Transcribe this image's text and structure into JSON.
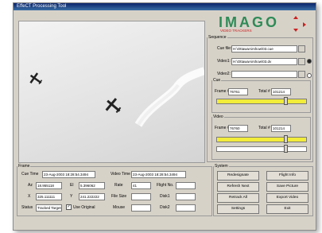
{
  "window": {
    "title": "EffeCT Processing Tool"
  },
  "logo": {
    "text": "IMAGO",
    "tagline": "VIDEO TRACKERS"
  },
  "sequence": {
    "legend": "Sequence",
    "cue_file_label": "Cue file:",
    "cue_file": "H:\\OttawaAirshow\\03.cue",
    "video1_label": "Video1:",
    "video1": "H:\\OttawaAirshow\\03.dv",
    "video2_label": "Video2:",
    "video2": "",
    "cue": {
      "legend": "Cue",
      "frame_label": "Frame #",
      "frame": "76761",
      "total_label": "Total #",
      "total": "101214",
      "progress": 0.76
    },
    "video": {
      "legend": "Video",
      "frame_label": "Frame #",
      "frame": "76760",
      "total_label": "Total #",
      "total": "101214",
      "progress": 0.76
    }
  },
  "frame": {
    "legend": "Frame",
    "cue_time_label": "Cue Time",
    "cue_time": "23-Aug-2003 18:28:54.3494",
    "video_time_label": "Video Time",
    "video_time": "23-Aug-2003 18:28:54.3494",
    "az_label": "Az",
    "az": "18.955118",
    "el_label": "El",
    "el": "5.396062",
    "rate_label": "Rate",
    "rate": "41",
    "flight_label": "Flight No.",
    "flight": "",
    "x_label": "X",
    "x": "325.111111",
    "y_label": "Y",
    "y": "241.222222",
    "filesize_label": "File Size",
    "filesize": "",
    "disk1_label": "Disk1",
    "disk1": "",
    "status_label": "Status",
    "status": "Tracked Target",
    "use_original_label": "Use Original",
    "mouse_label": "Mouse",
    "mouse": "",
    "disk2_label": "Disk2",
    "disk2": ""
  },
  "system": {
    "legend": "System",
    "buttons": [
      "Redesignate",
      "Flight Info",
      "Refresh Next",
      "Save Picture",
      "Retrack All",
      "Export Video",
      "Settings",
      "Exit"
    ]
  },
  "colors": {
    "progress_fill": "#f2ec3a",
    "logo_green": "#2e8b57",
    "logo_red": "#cc2222"
  }
}
